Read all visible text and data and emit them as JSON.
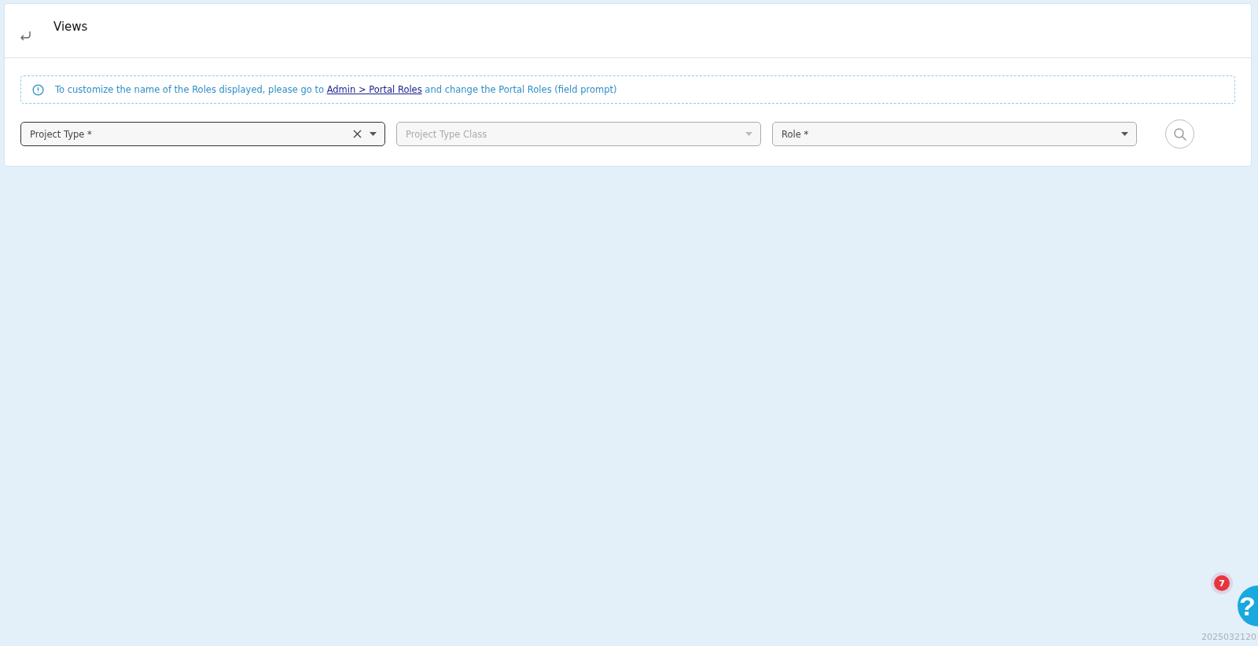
{
  "header": {
    "title": "Views"
  },
  "notice": {
    "before": "To customize the name of the Roles displayed, please go to ",
    "link": "Admin > Portal Roles",
    "after": " and change the Portal Roles (field prompt)"
  },
  "fields": [
    {
      "label": "Project Type *",
      "focused": true,
      "disabled": false,
      "clearable": true
    },
    {
      "label": "Project Type Class",
      "focused": false,
      "disabled": true,
      "clearable": false
    },
    {
      "label": "Role *",
      "focused": false,
      "disabled": false,
      "clearable": false
    }
  ],
  "help": {
    "badge": "7",
    "glyph": "?"
  },
  "version": "2025032120"
}
